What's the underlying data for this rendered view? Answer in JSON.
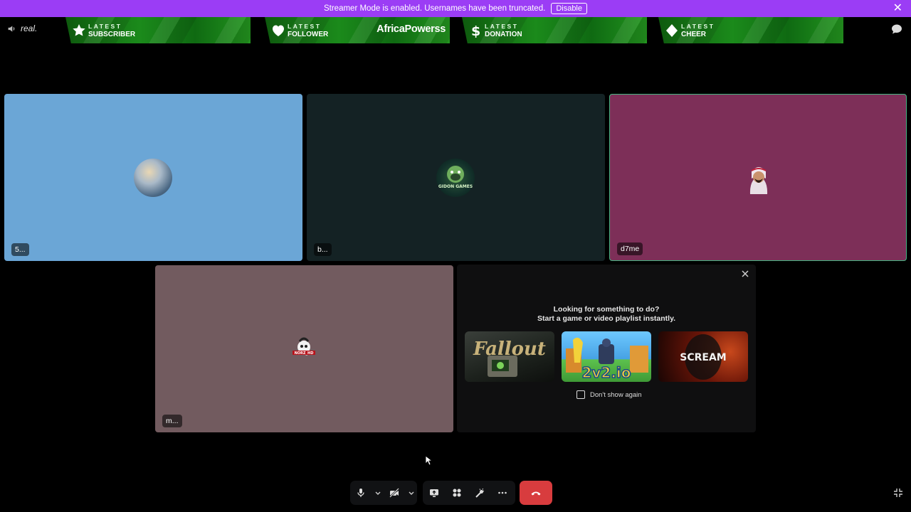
{
  "banner": {
    "message": "Streamer Mode is enabled. Usernames have been truncated.",
    "disable_label": "Disable"
  },
  "channel": {
    "name": "real."
  },
  "alerts": [
    {
      "latest": "LATEST",
      "kind": "SUBSCRIBER",
      "value": "",
      "icon": "star-icon"
    },
    {
      "latest": "LATEST",
      "kind": "FOLLOWER",
      "value": "AfricaPowerss",
      "icon": "heart-icon"
    },
    {
      "latest": "LATEST",
      "kind": "DONATION",
      "value": "",
      "icon": "dollar-icon"
    },
    {
      "latest": "LATEST",
      "kind": "CHEER",
      "value": "",
      "icon": "diamond-icon"
    }
  ],
  "participants": [
    {
      "name": "5...",
      "bg": "#6ba6d6"
    },
    {
      "name": "b...",
      "bg": "#142224"
    },
    {
      "name": "d7me",
      "bg": "#7d2f58"
    },
    {
      "name": "m...",
      "bg": "#725b5f"
    }
  ],
  "avatar_texts": {
    "gorilla": "GIDON GAMES",
    "skull": "NORZ_HD"
  },
  "activity": {
    "line1": "Looking for something to do?",
    "line2": "Start a game or video playlist instantly.",
    "cards": [
      {
        "title": "Fallout"
      },
      {
        "title": "2v2.io"
      },
      {
        "title": "SCREAM"
      }
    ],
    "dont_show": "Don't show again"
  },
  "colors": {
    "banner": "#9b3df5",
    "hangup": "#d83c3e",
    "alert_green": "#1b8a1b"
  }
}
